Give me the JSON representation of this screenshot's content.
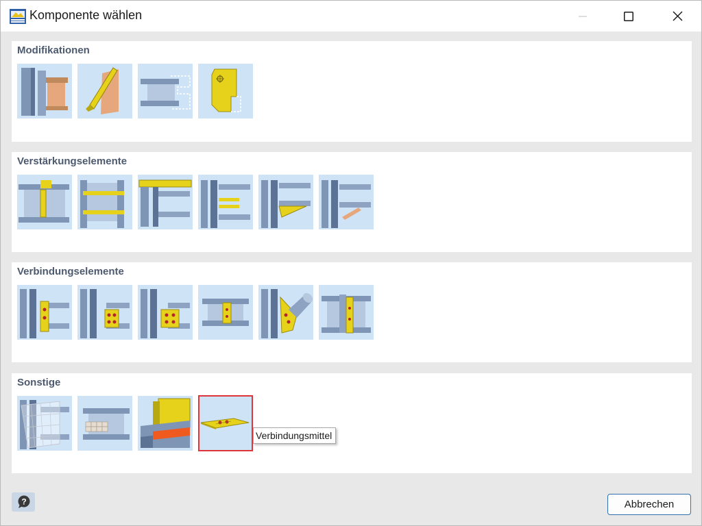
{
  "window": {
    "title": "Komponente wählen",
    "buttons": {
      "minimize": "minimize-icon",
      "maximize": "maximize-icon",
      "close": "close-icon"
    }
  },
  "sections": [
    {
      "title": "Modifikationen",
      "items": [
        "modification-1",
        "modification-2",
        "modification-3",
        "modification-4"
      ]
    },
    {
      "title": "Verstärkungselemente",
      "items": [
        "stiffener-1",
        "stiffener-2",
        "stiffener-3",
        "stiffener-4",
        "stiffener-5",
        "stiffener-6"
      ]
    },
    {
      "title": "Verbindungselemente",
      "items": [
        "connector-1",
        "connector-2",
        "connector-3",
        "connector-4",
        "connector-5",
        "connector-6"
      ]
    },
    {
      "title": "Sonstige",
      "items": [
        "misc-1",
        "misc-2",
        "misc-3",
        "misc-4"
      ]
    }
  ],
  "selected_item": "misc-4",
  "tooltip": "Verbindungsmittel",
  "footer": {
    "help_icon": "help-icon",
    "cancel_label": "Abbrechen"
  },
  "colors": {
    "tile_background": "#cfe3f7",
    "steel": "#7f95b5",
    "plate_yellow": "#e6d21a",
    "plate_orange": "#e6a77d",
    "selection_border": "#e0343b",
    "section_title": "#4d5a6e"
  }
}
